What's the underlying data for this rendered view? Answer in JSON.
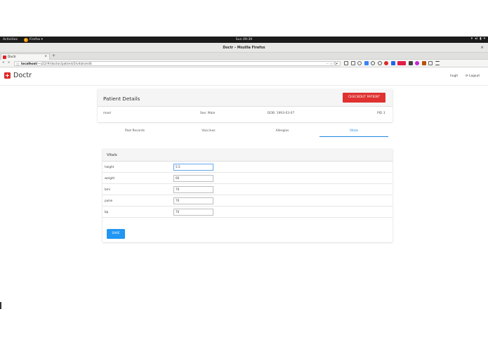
{
  "desktop": {
    "activities": "Activities",
    "app_menu": "Firefox ▾",
    "clock": "Sun 09:39"
  },
  "window": {
    "title": "Doctr – Mozilla Firefox",
    "close_glyph": "×"
  },
  "browser": {
    "tab_label": "Doctr",
    "tab_close": "×",
    "new_tab": "+",
    "url_host": "localhost",
    "url_path": "/~s22/#/doctor/patient/3/vitals/edit",
    "url_right": "⋯ ☆  Q▾"
  },
  "app": {
    "brand": "Doctr",
    "user": "hugh",
    "logout": "⟳ Logout"
  },
  "patient_card": {
    "title": "Patient Details",
    "checkout_label": "CHECKOUT PATIENT",
    "name": "mael",
    "sex": "Sex: Male",
    "dob": "DOB: 1993-03-07",
    "pid": "PID 3"
  },
  "tabs": [
    {
      "label": "Past Records",
      "active": false
    },
    {
      "label": "Vaccines",
      "active": false
    },
    {
      "label": "Allergies",
      "active": false
    },
    {
      "label": "Vitals",
      "active": true
    }
  ],
  "vitals": {
    "title": "Vitals",
    "rows": [
      {
        "label": "height",
        "value": "5.5"
      },
      {
        "label": "weight",
        "value": "60"
      },
      {
        "label": "bmi",
        "value": "70"
      },
      {
        "label": "pulse",
        "value": "70"
      },
      {
        "label": "bp",
        "value": "70"
      }
    ],
    "save_label": "SAVE"
  },
  "colors": {
    "brand_red": "#dd2a2a",
    "checkout_red": "#e03131",
    "accent_blue": "#1e88e5",
    "save_blue": "#2196f3"
  }
}
